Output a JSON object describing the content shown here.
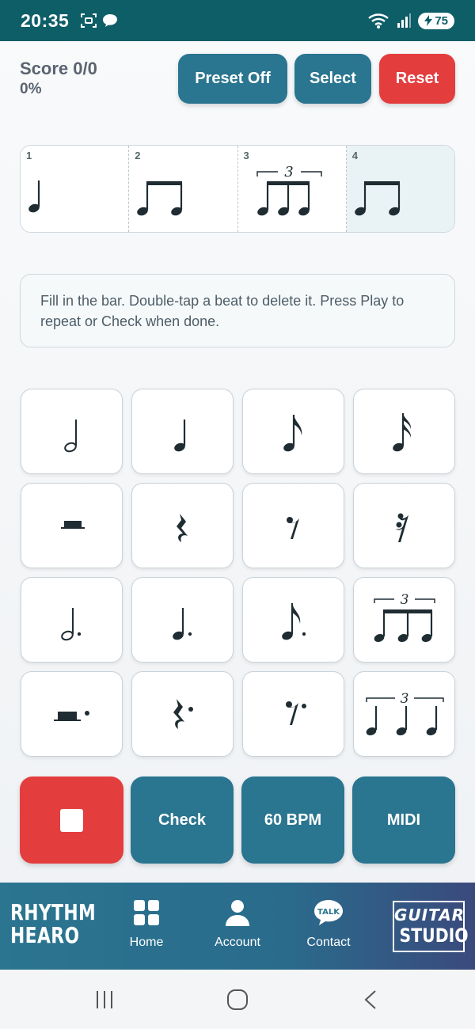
{
  "status": {
    "time": "20:35",
    "network_sup": "6",
    "battery": "75"
  },
  "score": {
    "label": "Score 0/0",
    "percent": "0%"
  },
  "top_buttons": {
    "preset": "Preset Off",
    "select": "Select",
    "reset": "Reset"
  },
  "measure": {
    "beats": [
      {
        "num": "1",
        "content": "quarter-note"
      },
      {
        "num": "2",
        "content": "two-eighth-notes"
      },
      {
        "num": "3",
        "content": "eighth-triplet",
        "tuplet": "3"
      },
      {
        "num": "4",
        "content": "two-eighth-notes"
      }
    ],
    "active_beat": 4
  },
  "instructions": "Fill in the bar. Double-tap a beat to delete it. Press Play to repeat or Check when done.",
  "palette": [
    "half-note",
    "quarter-note",
    "eighth-note",
    "sixteenth-note",
    "half-rest",
    "quarter-rest",
    "eighth-rest",
    "sixteenth-rest",
    "dotted-half-note",
    "dotted-quarter-note",
    "dotted-eighth-note",
    "eighth-triplet",
    "dotted-half-rest",
    "dotted-quarter-rest",
    "dotted-eighth-rest",
    "quarter-triplet"
  ],
  "tuplet_label": "3",
  "actions": {
    "stop": "stop",
    "check": "Check",
    "tempo": "60 BPM",
    "midi": "MIDI"
  },
  "nav": {
    "brand_line1": "RHYTHM",
    "brand_line2": "HEARO",
    "home": "Home",
    "account": "Account",
    "contact": "Contact",
    "talk_bubble": "TALK",
    "studio_line1": "GUITAR",
    "studio_line2": "STUDIO"
  },
  "colors": {
    "teal": "#2a7590",
    "red": "#e43d3e",
    "status_bar": "#0e5e68",
    "ink": "#1f2d33"
  }
}
